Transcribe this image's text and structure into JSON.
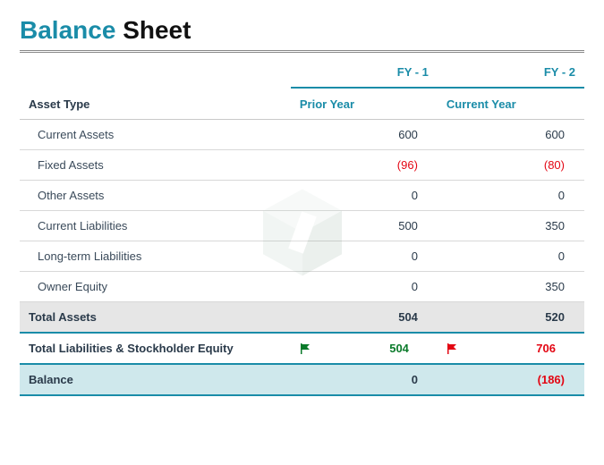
{
  "title": {
    "part1": "Balance",
    "part2": "Sheet"
  },
  "columns": {
    "fy1": "FY - 1",
    "fy2": "FY - 2",
    "asset_type": "Asset Type",
    "prior": "Prior Year",
    "current": "Current Year"
  },
  "rows": [
    {
      "label": "Current Assets",
      "v1": "600",
      "v2": "600"
    },
    {
      "label": "Fixed Assets",
      "v1": "(96)",
      "v1_neg": true,
      "v2": "(80)",
      "v2_neg": true
    },
    {
      "label": "Other Assets",
      "v1": "0",
      "v2": "0"
    },
    {
      "label": "Current Liabilities",
      "v1": "500",
      "v2": "350"
    },
    {
      "label": "Long-term Liabilities",
      "v1": "0",
      "v2": "0"
    },
    {
      "label": "Owner Equity",
      "v1": "0",
      "v2": "350"
    }
  ],
  "totals": {
    "assets": {
      "label": "Total Assets",
      "v1": "504",
      "v2": "520"
    },
    "liab_equity": {
      "label": "Total Liabilities & Stockholder Equity",
      "v1": "504",
      "v1_status": "ok",
      "v2": "706",
      "v2_status": "bad"
    },
    "balance": {
      "label": "Balance",
      "v1": "0",
      "v2": "(186)",
      "v2_neg": true
    }
  },
  "chart_data": {
    "type": "table",
    "title": "Balance Sheet",
    "columns": [
      "Asset Type",
      "FY - 1 (Prior Year)",
      "FY - 2 (Current Year)"
    ],
    "rows": [
      [
        "Current Assets",
        600,
        600
      ],
      [
        "Fixed Assets",
        -96,
        -80
      ],
      [
        "Other Assets",
        0,
        0
      ],
      [
        "Current Liabilities",
        500,
        350
      ],
      [
        "Long-term Liabilities",
        0,
        0
      ],
      [
        "Owner Equity",
        0,
        350
      ],
      [
        "Total Assets",
        504,
        520
      ],
      [
        "Total Liabilities & Stockholder Equity",
        504,
        706
      ],
      [
        "Balance",
        0,
        -186
      ]
    ]
  }
}
